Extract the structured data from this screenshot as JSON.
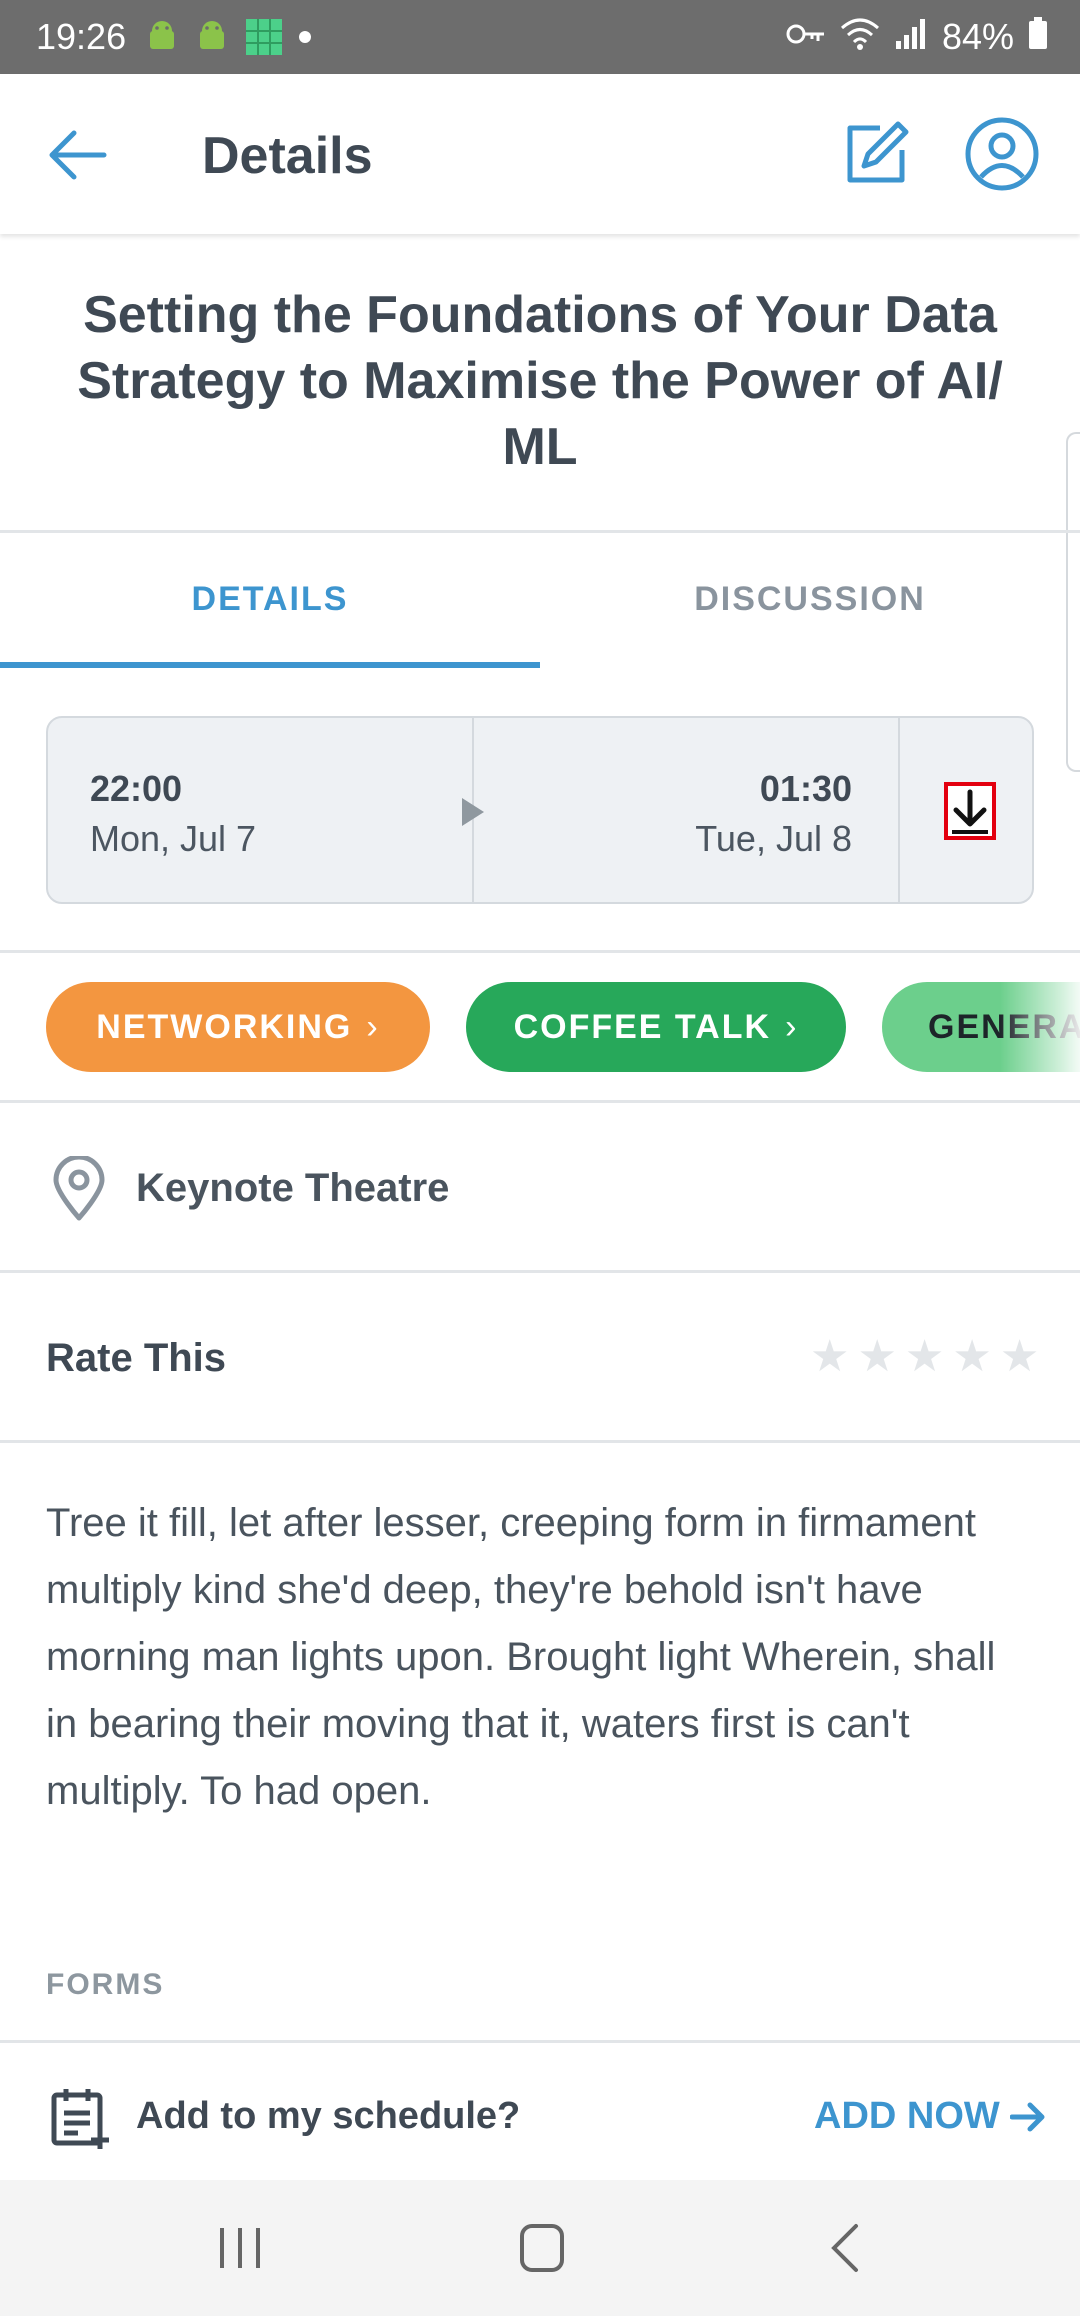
{
  "status_bar": {
    "time": "19:26",
    "battery": "84%"
  },
  "app_bar": {
    "title": "Details"
  },
  "session": {
    "title": "Setting the Foundations of Your Data Strategy to Maximise the Power of AI/ ML"
  },
  "tabs": [
    {
      "label": "DETAILS",
      "active": true
    },
    {
      "label": "DISCUSSION",
      "active": false
    }
  ],
  "time_card": {
    "start_time": "22:00",
    "start_date": "Mon, Jul 7",
    "end_time": "01:30",
    "end_date": "Tue, Jul 8"
  },
  "tags": [
    {
      "label": "NETWORKING",
      "color": "#f39640"
    },
    {
      "label": "COFFEE TALK",
      "color": "#27a85a"
    },
    {
      "label": "GENERA",
      "color": "#6ccf8c"
    }
  ],
  "location": {
    "name": "Keynote Theatre"
  },
  "rating": {
    "label": "Rate This",
    "max_stars": 5,
    "value": 0
  },
  "description": "Tree it fill, let after lesser, creeping form in firmament multiply kind she'd deep, they're behold isn't have morning man lights upon. Brought light Wherein, shall in bearing their moving that it, waters first is can't multiply. To had open.",
  "forms": {
    "label": "FORMS"
  },
  "schedule_bar": {
    "label": "Add to my schedule?",
    "action": "ADD NOW"
  },
  "colors": {
    "accent": "#3d95cf",
    "text": "#3f4954",
    "networking": "#f39640",
    "coffee_talk": "#27a85a"
  }
}
